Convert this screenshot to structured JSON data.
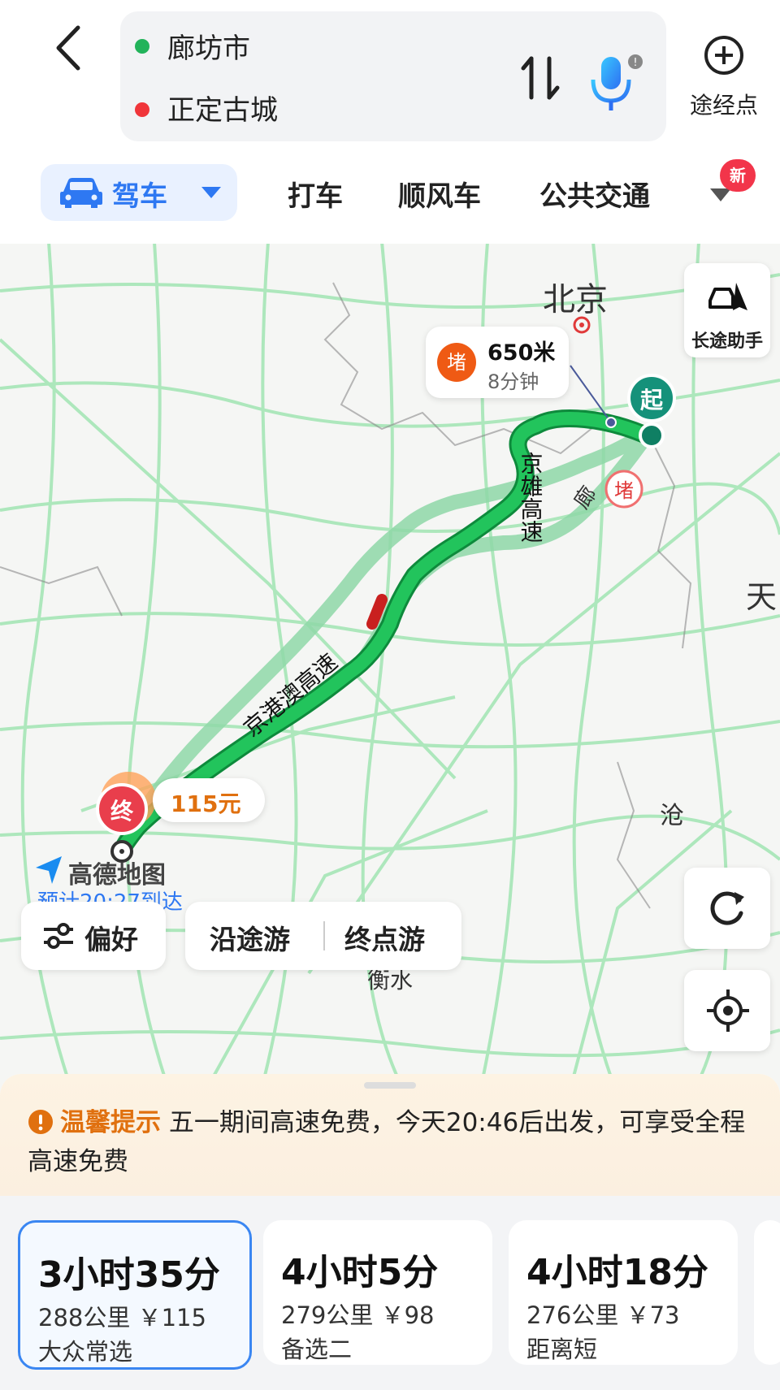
{
  "route": {
    "origin": "廊坊市",
    "destination": "正定古城",
    "waypoint_label": "途经点"
  },
  "modes": {
    "active": "驾车",
    "tabs": [
      "打车",
      "顺风车",
      "公共交通"
    ],
    "new_badge": "新"
  },
  "map": {
    "city_labels": {
      "beijing": "北京",
      "tianjin": "天",
      "cangzhou": "沧",
      "hengshui": "衡水"
    },
    "highway_labels": {
      "jingxiong": "京雄高速",
      "jinggangao": "京港澳高速",
      "lang": "廊"
    },
    "start_marker": "起",
    "end_marker": "终",
    "jam_marker": "堵",
    "jam_bubble": {
      "badge": "堵",
      "distance": "650米",
      "duration": "8分钟"
    },
    "toll_bubble": "115元",
    "logo_text": "高德地图",
    "eta_text": "预计20:27到达",
    "assistant_label": "长途助手",
    "preference_label": "偏好",
    "along_tour_label": "沿途游",
    "dest_tour_label": "终点游"
  },
  "tip": {
    "title": "温馨提示",
    "message": "五一期间高速免费，今天20:46后出发，可享受全程高速免费"
  },
  "plans": [
    {
      "time": "3小时35分",
      "info": "288公里  ￥115",
      "tag": "大众常选",
      "selected": true
    },
    {
      "time": "4小时5分",
      "info": "279公里  ￥98",
      "tag": "备选二",
      "selected": false
    },
    {
      "time": "4小时18分",
      "info": "276公里  ￥73",
      "tag": "距离短",
      "selected": false
    }
  ],
  "colors": {
    "accent": "#2e78f2",
    "route_main": "#1fbf5a",
    "route_alt": "#8fd8a8",
    "warn": "#e0700f",
    "jam": "#ef5a14"
  }
}
